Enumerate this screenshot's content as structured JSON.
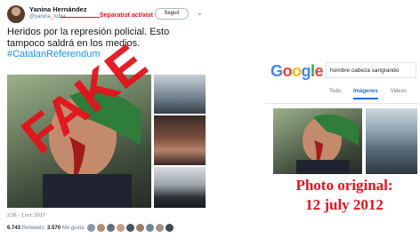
{
  "tweet": {
    "author_name": "Yanina Hernández",
    "author_handle": "@yanina_rubia",
    "annotation": "Separatist activist",
    "follow_label": "Seguir",
    "caret_icon": "chevron-down-icon",
    "text_lines": [
      "Heridos por la represión policial. Esto",
      "tampoco saldrá en los medios.",
      "#CatalanReferendum"
    ],
    "stamp": "FAKE",
    "date": "2:36 - 1 oct. 2017",
    "retweets_count": "6.743",
    "retweets_label": "Retweets",
    "likes_count": "3.570",
    "likes_label": "Me gusta",
    "liker_avatar_count": 9
  },
  "google": {
    "logo": {
      "letters": [
        {
          "ch": "G",
          "color": "#4285f4"
        },
        {
          "ch": "o",
          "color": "#ea4335"
        },
        {
          "ch": "o",
          "color": "#fbbc05"
        },
        {
          "ch": "g",
          "color": "#4285f4"
        },
        {
          "ch": "l",
          "color": "#34a853"
        },
        {
          "ch": "e",
          "color": "#ea4335"
        }
      ]
    },
    "query": "hombre cabeza sangrando",
    "tabs": [
      {
        "label": "Todo",
        "active": false
      },
      {
        "label": "Imágenes",
        "active": true
      },
      {
        "label": "Videos",
        "active": false
      }
    ]
  },
  "caption": {
    "line1": "Photo original:",
    "line2": "12 july 2012"
  },
  "colors": {
    "stamp_red": "#e3141c",
    "link_blue": "#1a73e8"
  }
}
